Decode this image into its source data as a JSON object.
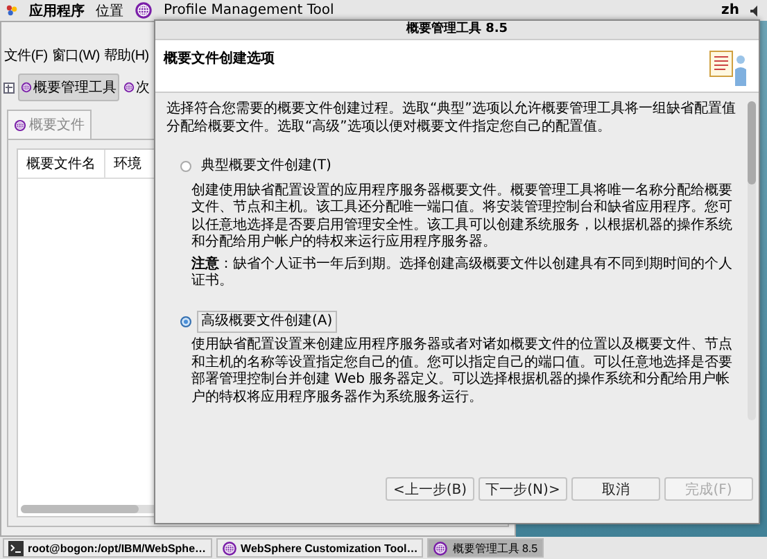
{
  "top_panel": {
    "apps_menu": "应用程序",
    "places_menu": "位置",
    "window_title": "Profile Management Tool",
    "language": "zh"
  },
  "main_window": {
    "menu": [
      "文件(F)",
      "窗口(W)",
      "帮助(H)"
    ],
    "toolbar": [
      {
        "label": "概要管理工具",
        "selected": true
      },
      {
        "label": "次",
        "selected": false
      }
    ],
    "view_tab": "概要文件",
    "table_columns": [
      "概要文件名",
      "环境"
    ]
  },
  "dialog": {
    "title": "概要管理工具 8.5",
    "heading": "概要文件创建选项",
    "intro": "选择符合您需要的概要文件创建过程。选取“典型”选项以允许概要管理工具将一组缺省配置值分配给概要文件。选取“高级”选项以便对概要文件指定您自己的配置值。",
    "options": [
      {
        "label": "典型概要文件创建(T)",
        "selected": false,
        "description": "创建使用缺省配置设置的应用程序服务器概要文件。概要管理工具将唯一名称分配给概要文件、节点和主机。该工具还分配唯一端口值。将安装管理控制台和缺省应用程序。您可以任意地选择是否要启用管理安全性。该工具可以创建系统服务，以根据机器的操作系统和分配给用户帐户的特权来运行应用程序服务器。",
        "note": "**注意**：缺省个人证书一年后到期。选择创建高级概要文件以创建具有不同到期时间的个人证书。"
      },
      {
        "label": "高级概要文件创建(A)",
        "selected": true,
        "description": "使用缺省配置设置来创建应用程序服务器或者对诸如概要文件的位置以及概要文件、节点和主机的名称等设置指定您自己的值。您可以指定自己的端口值。可以任意地选择是否要部署管理控制台并创建 Web 服务器定义。可以选择根据机器的操作系统和分配给用户帐户的特权将应用程序服务器作为系统服务运行。"
      }
    ],
    "buttons": [
      {
        "label": "<上一步(B)",
        "disabled": false
      },
      {
        "label": "下一步(N)>",
        "disabled": false
      },
      {
        "label": "取消",
        "disabled": false
      },
      {
        "label": "完成(F)",
        "disabled": true
      }
    ]
  },
  "taskbar": [
    {
      "label": "root@bogon:/opt/IBM/WebSphe…",
      "kind": "terminal",
      "selected": false
    },
    {
      "label": "WebSphere Customization Tool…",
      "kind": "app",
      "selected": false
    },
    {
      "label": "概要管理工具 8.5",
      "kind": "app",
      "selected": true
    }
  ]
}
